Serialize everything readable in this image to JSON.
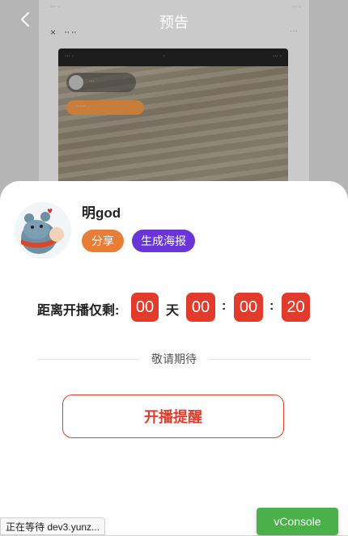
{
  "header": {
    "title": "预告"
  },
  "host": {
    "name": "明god"
  },
  "actions": {
    "share_label": "分享",
    "poster_label": "生成海报"
  },
  "countdown": {
    "label": "距离开播仅剩:",
    "days": "00",
    "day_unit": "天",
    "hours": "00",
    "minutes": "00",
    "seconds": "20",
    "separator": ":"
  },
  "divider": {
    "text": "敬请期待"
  },
  "remind": {
    "label": "开播提醒"
  },
  "browser_status": {
    "text": "正在等待 dev3.yunz..."
  },
  "vconsole": {
    "label": "vConsole"
  },
  "colors": {
    "accent_red": "#e33b2b",
    "share_orange": "#e87d36",
    "poster_purple": "#6a35d6",
    "vconsole_green": "#4ab04a"
  }
}
